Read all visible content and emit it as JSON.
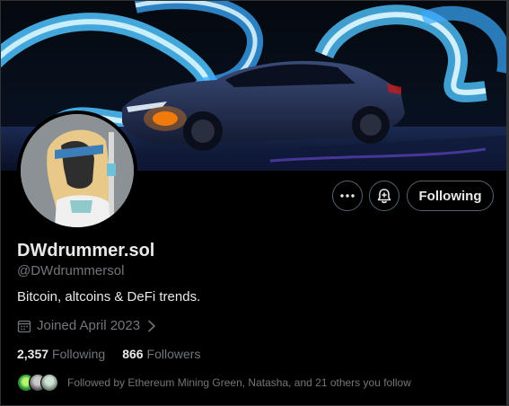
{
  "profile": {
    "display_name": "DWdrummer.sol",
    "handle": "@DWdrummersol",
    "bio": "Bitcoin, altcoins & DeFi trends.",
    "joined": "Joined April 2023"
  },
  "actions": {
    "more_icon": "more-horizontal-icon",
    "bell_icon": "notification-bell-plus-icon",
    "follow_label": "Following"
  },
  "stats": {
    "following_count": "2,357",
    "following_label": "Following",
    "followers_count": "866",
    "followers_label": "Followers"
  },
  "followed_by": {
    "text": "Followed by Ethereum Mining Green, Natasha, and 21 others you follow"
  },
  "colors": {
    "background": "#000000",
    "text_primary": "#e7e9ea",
    "text_secondary": "#71767b",
    "border": "#536471",
    "neon_blue": "#4fc3ff"
  }
}
